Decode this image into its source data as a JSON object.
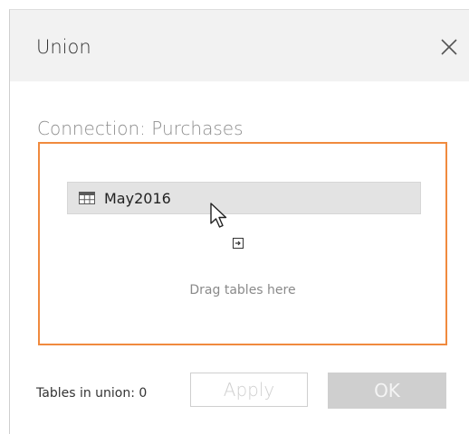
{
  "dialog": {
    "title": "Union",
    "close_icon": "close-icon"
  },
  "connection": {
    "label": "Connection: Purchases"
  },
  "dropzone": {
    "border_color": "#f08a3e",
    "table": {
      "icon": "table-grid-icon",
      "name": "May2016"
    },
    "hint": "Drag tables here",
    "cursor_icon": "pointer-cursor-icon",
    "drop_icon": "drop-add-icon"
  },
  "footer": {
    "tables_count_label": "Tables in union: 0",
    "apply_label": "Apply",
    "ok_label": "OK"
  }
}
